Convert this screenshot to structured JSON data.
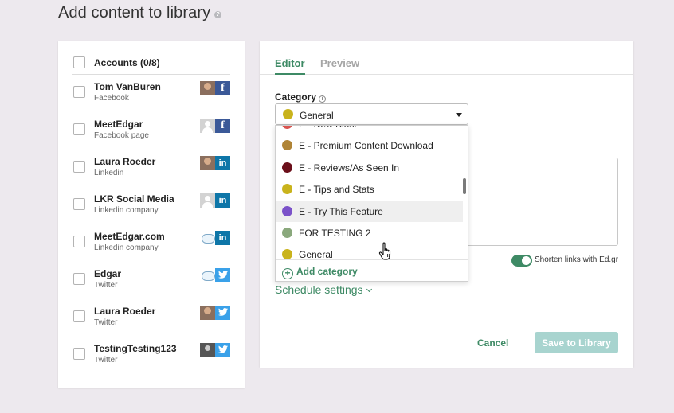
{
  "page_title": "Add content to library",
  "help_glyph": "?",
  "accounts": {
    "header": "Accounts (0/8)",
    "items": [
      {
        "name": "Tom VanBuren",
        "type": "Facebook",
        "network": "f",
        "avatar": "person"
      },
      {
        "name": "MeetEdgar",
        "type": "Facebook page",
        "network": "f",
        "avatar": "generic"
      },
      {
        "name": "Laura Roeder",
        "type": "Linkedin",
        "network": "in",
        "avatar": "person"
      },
      {
        "name": "LKR Social Media",
        "type": "Linkedin company",
        "network": "in",
        "avatar": "generic"
      },
      {
        "name": "MeetEdgar.com",
        "type": "Linkedin company",
        "network": "in",
        "avatar": "logo"
      },
      {
        "name": "Edgar",
        "type": "Twitter",
        "network": "t",
        "avatar": "logo"
      },
      {
        "name": "Laura Roeder",
        "type": "Twitter",
        "network": "t",
        "avatar": "person"
      },
      {
        "name": "TestingTesting123",
        "type": "Twitter",
        "network": "t",
        "avatar": "dark"
      }
    ]
  },
  "editor": {
    "tabs": [
      {
        "label": "Editor",
        "active": true
      },
      {
        "label": "Preview",
        "active": false
      }
    ],
    "category_label": "Category",
    "info_glyph": "i",
    "selected_category": {
      "label": "General",
      "color": "#c9b31c"
    },
    "shorten_links_label": "Shorten links with Ed.gr",
    "shorten_links_on": true,
    "schedule_settings": "Schedule settings",
    "cancel_label": "Cancel",
    "save_label": "Save to Library"
  },
  "dropdown": {
    "options": [
      {
        "label": "E - New Blost",
        "color": "#d9534f"
      },
      {
        "label": "E - Premium Content Download",
        "color": "#b08436"
      },
      {
        "label": "E - Reviews/As Seen In",
        "color": "#6b0f1a"
      },
      {
        "label": "E - Tips and Stats",
        "color": "#c9b31c"
      },
      {
        "label": "E - Try This Feature",
        "color": "#7b52c9",
        "hover": true
      },
      {
        "label": "FOR TESTING 2",
        "color": "#8aa87c"
      },
      {
        "label": "General",
        "color": "#c9b31c"
      }
    ],
    "add_label": "Add category",
    "add_glyph": "+"
  },
  "icons": {
    "facebook": "f",
    "linkedin": "in",
    "twitter": "twitter-bird",
    "cursor": "hand-pointer"
  },
  "colors": {
    "accent": "#3e8a65",
    "save_disabled": "#a8d4cf",
    "background": "#ede9ee"
  }
}
